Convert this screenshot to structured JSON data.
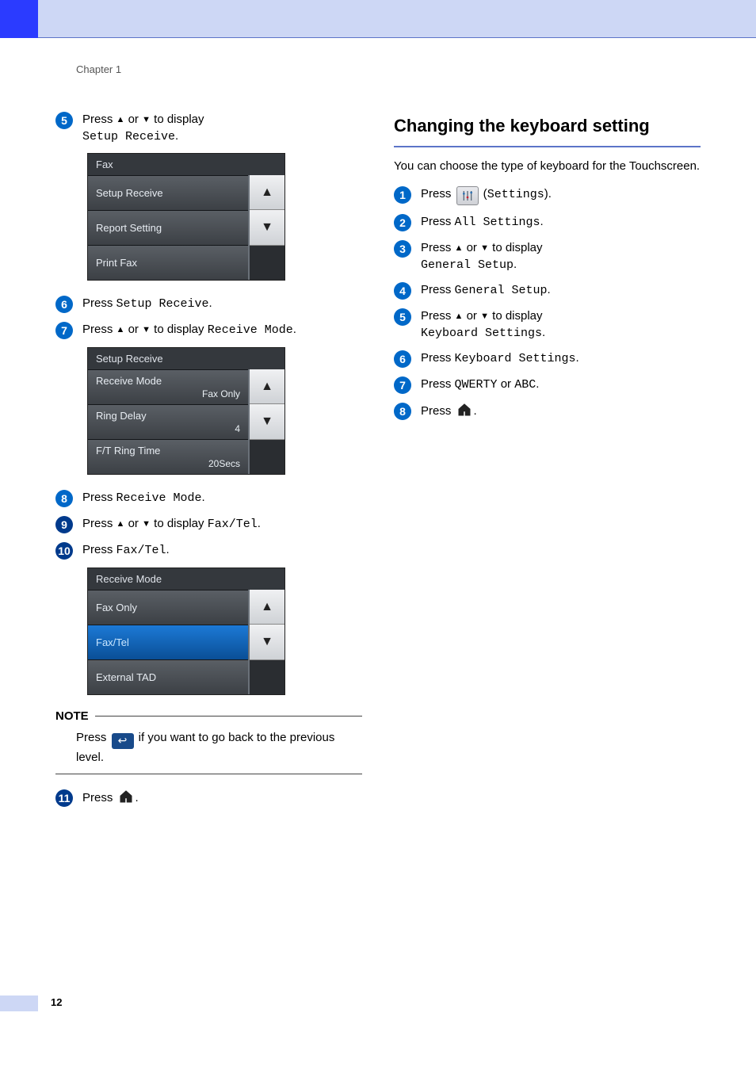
{
  "meta": {
    "chapter": "Chapter 1",
    "page_number": "12"
  },
  "left": {
    "steps": [
      {
        "n": "5",
        "num_class": "b-blue",
        "prefix": "Press ",
        "mid_a": "a",
        "or": " or ",
        "mid_b": "b",
        "suffix": " to display",
        "line2_mono": "Setup Receive",
        "line2_tail": "."
      },
      {
        "n": "6",
        "num_class": "b-blue",
        "prefix": "Press ",
        "mono": "Setup Receive",
        "tail": "."
      },
      {
        "n": "7",
        "num_class": "b-blue",
        "prefix": "Press ",
        "mid_a": "a",
        "or": " or ",
        "mid_b": "b",
        "suffix": " to display ",
        "mono_inline": "Receive Mode",
        "tail": "."
      },
      {
        "n": "8",
        "num_class": "b-blue",
        "prefix": "Press ",
        "mono": "Receive Mode",
        "tail": "."
      },
      {
        "n": "9",
        "num_class": "b-dblue",
        "prefix": "Press ",
        "mid_a": "a",
        "or": " or ",
        "mid_b": "b",
        "suffix": " to display ",
        "mono_inline": "Fax/Tel",
        "tail": "."
      },
      {
        "n": "10",
        "num_class": "b-dblue",
        "prefix": "Press ",
        "mono": "Fax/Tel",
        "tail": "."
      },
      {
        "n": "11",
        "num_class": "b-dblue",
        "prefix": "Press ",
        "icon": "home",
        "tail": "."
      }
    ],
    "note": {
      "label": "NOTE",
      "body_pre": "Press ",
      "body_post": " if you want to go back to the previous level."
    },
    "screen1": {
      "title": "Fax",
      "rows": [
        {
          "label": "Setup Receive"
        },
        {
          "label": "Report Setting"
        },
        {
          "label": "Print Fax"
        }
      ]
    },
    "screen2": {
      "title": "Setup Receive",
      "rows": [
        {
          "label": "Receive Mode",
          "value": "Fax Only"
        },
        {
          "label": "Ring Delay",
          "value": "4"
        },
        {
          "label": "F/T Ring Time",
          "value": "20Secs"
        }
      ]
    },
    "screen3": {
      "title": "Receive Mode",
      "rows": [
        {
          "label": "Fax Only"
        },
        {
          "label": "Fax/Tel",
          "selected": true
        },
        {
          "label": "External TAD"
        }
      ]
    }
  },
  "right": {
    "heading": "Changing the keyboard setting",
    "intro": "You can choose the type of keyboard for the Touchscreen.",
    "steps": [
      {
        "n": "1",
        "num_class": "b-blue",
        "prefix": "Press ",
        "icon": "settings",
        "post_open": " (",
        "mono": "Settings",
        "post_close": ")."
      },
      {
        "n": "2",
        "num_class": "b-blue",
        "prefix": "Press ",
        "mono": "All Settings",
        "tail": "."
      },
      {
        "n": "3",
        "num_class": "b-blue",
        "prefix": "Press ",
        "mid_a": "a",
        "or": " or ",
        "mid_b": "b",
        "suffix": " to display",
        "line2_mono": "General Setup",
        "line2_tail": "."
      },
      {
        "n": "4",
        "num_class": "b-blue",
        "prefix": "Press ",
        "mono": "General Setup",
        "tail": "."
      },
      {
        "n": "5",
        "num_class": "b-blue",
        "prefix": "Press ",
        "mid_a": "a",
        "or": " or ",
        "mid_b": "b",
        "suffix": " to display",
        "line2_mono": "Keyboard Settings",
        "line2_tail": "."
      },
      {
        "n": "6",
        "num_class": "b-blue",
        "prefix": "Press ",
        "mono": "Keyboard Settings",
        "tail": "."
      },
      {
        "n": "7",
        "num_class": "b-blue",
        "prefix": "Press ",
        "mono": "QWERTY",
        "mid_text": " or ",
        "mono2": "ABC",
        "tail": "."
      },
      {
        "n": "8",
        "num_class": "b-blue",
        "prefix": "Press ",
        "icon": "home",
        "tail": "."
      }
    ]
  }
}
